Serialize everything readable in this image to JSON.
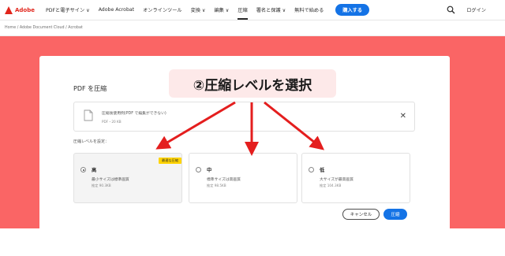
{
  "nav": {
    "brand": "Adobe",
    "items": [
      "PDFと電子サイン ∨",
      "Adobe Acrobat",
      "オンラインツール",
      "変換 ∨",
      "編集 ∨",
      "圧縮",
      "署名と保護 ∨",
      "無料で始める"
    ],
    "buy_label": "購入する",
    "login_label": "ログイン"
  },
  "breadcrumb": "Home  /  Adobe Document Cloud  /  Acrobat",
  "card": {
    "title": "PDF を圧縮",
    "file_name": "圧縮後使用例(PDF で編集ができない)",
    "file_size": "PDF・20 KB",
    "close_label": "✕",
    "setting_label": "圧縮レベルを設定：",
    "options": [
      {
        "title": "高",
        "desc": "最小サイズは標準画質",
        "est": "推定 90.3KB",
        "badge": "最適な圧縮"
      },
      {
        "title": "中",
        "desc": "標準サイズは高画質",
        "est": "推定 98.5KB"
      },
      {
        "title": "低",
        "desc": "大サイズが最高画質",
        "est": "推定 104.3KB"
      }
    ],
    "cancel_label": "キャンセル",
    "compress_label": "圧縮"
  },
  "annotation": {
    "text": "②圧縮レベルを選択",
    "arrow_color": "#e41e1e"
  },
  "colors": {
    "hero": "#fa6565",
    "accent": "#1473e6",
    "brand": "#e1251b",
    "badge": "#ffd400"
  }
}
